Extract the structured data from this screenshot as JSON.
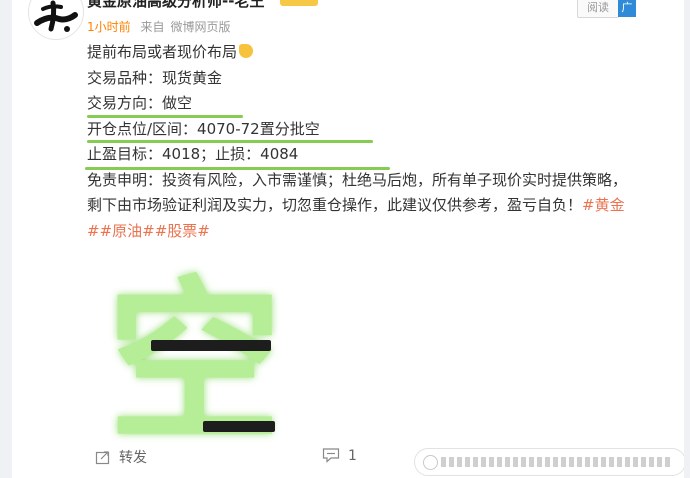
{
  "post": {
    "author": "黄金原油高级分析师--老王",
    "time": "1小时前",
    "source_prefix": "来自",
    "source": "微博网页版",
    "read_label": "阅读",
    "ad_label": "广",
    "lines": {
      "l1": "提前布局或者现价布局",
      "l2": "交易品种：现货黄金",
      "l3": "交易方向：做空",
      "l4": "开仓点位/区间：4070-72置分批空",
      "l5": "止盈目标：4018；止损：4084",
      "l6": "免责申明：投资有风险，入市需谨慎；杜绝马后炮，所有单子现价实时提供策略，",
      "l7": "剩下由市场验证利润及实力，切忽重仓操作，此建议仅供参考，盈亏自负！",
      "tag1": "#黄金",
      "tag2": "##原油##股票#"
    },
    "image_char": "空",
    "repost_label": "转发",
    "comment_count": "1"
  },
  "colors": {
    "accent_orange": "#ff8200",
    "tag_orange": "#eb7350",
    "underline_green": "#86cc52",
    "glyph_green": "#9be27a"
  },
  "icons": [
    "hand-emoji-icon",
    "repost-icon",
    "comment-icon",
    "vip-badge-icon",
    "avatar-calligraphy-icon"
  ]
}
